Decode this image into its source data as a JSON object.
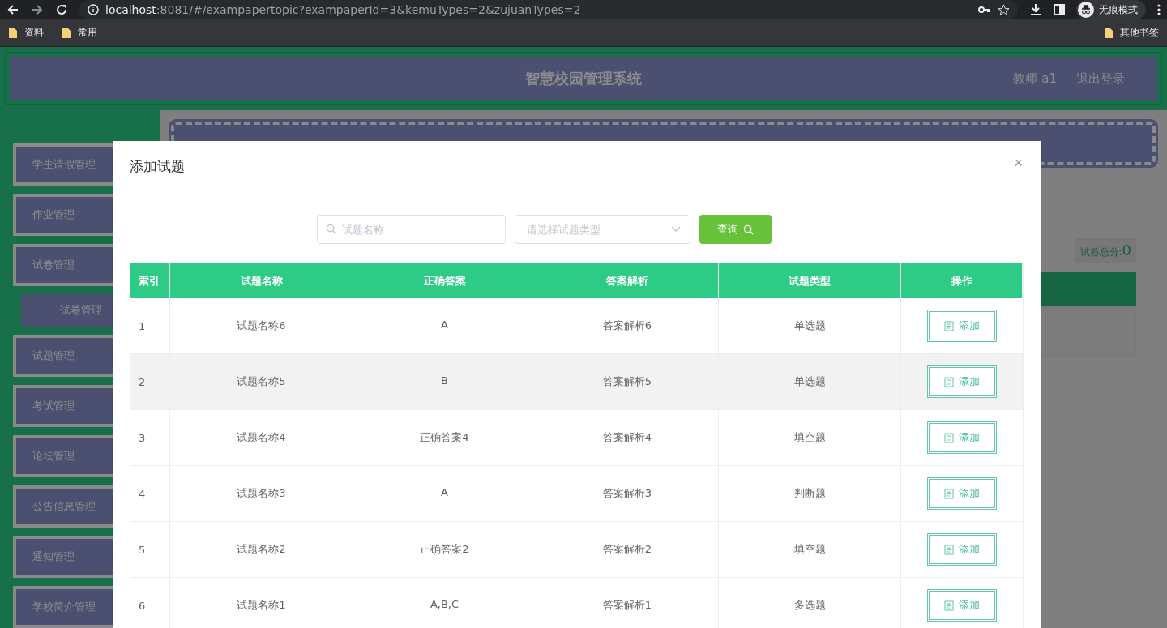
{
  "browser": {
    "url_host": "localhost",
    "url_rest": ":8081/#/exampapertopic?exampaperId=3&kemuTypes=2&zujuanTypes=2",
    "incognito_label": "无痕模式",
    "bookmarks": [
      "资料",
      "常用"
    ],
    "other_bookmarks": "其他书签"
  },
  "header": {
    "title": "智慧校园管理系统",
    "user": "教师 a1",
    "logout": "退出登录"
  },
  "sidebar": {
    "items": [
      {
        "label": "学生请假管理",
        "sub": false
      },
      {
        "label": "作业管理",
        "sub": false
      },
      {
        "label": "试卷管理",
        "sub": false
      },
      {
        "label": "试卷管理",
        "sub": true
      },
      {
        "label": "试题管理",
        "sub": false
      },
      {
        "label": "考试管理",
        "sub": false
      },
      {
        "label": "论坛管理",
        "sub": false
      },
      {
        "label": "公告信息管理",
        "sub": false
      },
      {
        "label": "通知管理",
        "sub": false
      },
      {
        "label": "学校简介管理",
        "sub": false
      }
    ]
  },
  "content": {
    "total_label": "试卷总分:",
    "total_value": "0"
  },
  "dialog": {
    "title": "添加试题",
    "close": "×",
    "search": {
      "placeholder": "试题名称"
    },
    "type_select": {
      "placeholder": "请选择试题类型"
    },
    "query_button": "查询",
    "table": {
      "columns": [
        "索引",
        "试题名称",
        "正确答案",
        "答案解析",
        "试题类型",
        "操作"
      ],
      "rows": [
        {
          "cells": [
            "1",
            "试题名称6",
            "A",
            "答案解析6",
            "单选题"
          ],
          "action": "添加",
          "highlighted": false
        },
        {
          "cells": [
            "2",
            "试题名称5",
            "B",
            "答案解析5",
            "单选题"
          ],
          "action": "添加",
          "highlighted": true
        },
        {
          "cells": [
            "3",
            "试题名称4",
            "正确答案4",
            "答案解析4",
            "填空题"
          ],
          "action": "添加",
          "highlighted": false
        },
        {
          "cells": [
            "4",
            "试题名称3",
            "A",
            "答案解析3",
            "判断题"
          ],
          "action": "添加",
          "highlighted": false
        },
        {
          "cells": [
            "5",
            "试题名称2",
            "正确答案2",
            "答案解析2",
            "填空题"
          ],
          "action": "添加",
          "highlighted": false
        },
        {
          "cells": [
            "6",
            "试题名称1",
            "A,B,C",
            "答案解析1",
            "多选题"
          ],
          "action": "添加",
          "highlighted": false
        }
      ]
    }
  }
}
